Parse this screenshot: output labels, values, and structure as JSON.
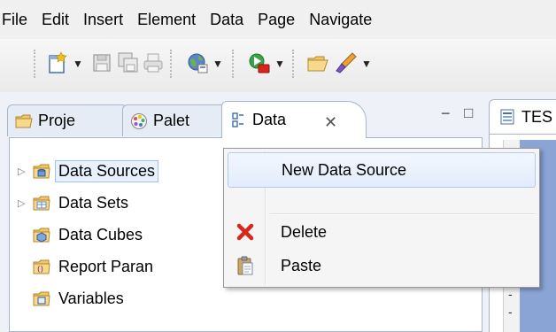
{
  "menubar": {
    "items": [
      "File",
      "Edit",
      "Insert",
      "Element",
      "Data",
      "Page",
      "Navigate"
    ]
  },
  "toolbar": {
    "buttons": [
      "new-file-icon",
      "save-icon",
      "save-all-icon",
      "print-icon",
      "globe-run-icon",
      "run-report-icon",
      "open-folder-icon",
      "brush-icon"
    ]
  },
  "tabs": {
    "project": "Proje",
    "palette": "Palet",
    "data": "Data",
    "close": "✕",
    "minimize": "−",
    "maximize": "□"
  },
  "editor_tab": {
    "label": "TES"
  },
  "tree": {
    "items": [
      {
        "label": "Data Sources",
        "expandable": true,
        "selected": true
      },
      {
        "label": "Data Sets",
        "expandable": true,
        "selected": false
      },
      {
        "label": "Data Cubes",
        "expandable": false,
        "selected": false
      },
      {
        "label": "Report Paran",
        "expandable": false,
        "selected": false
      },
      {
        "label": "Variables",
        "expandable": false,
        "selected": false
      }
    ]
  },
  "context_menu": {
    "items": [
      {
        "label": "New Data Source",
        "icon": "",
        "highlighted": true
      },
      {
        "label": "Delete",
        "icon": "delete-icon",
        "highlighted": false
      },
      {
        "label": "Paste",
        "icon": "paste-icon",
        "highlighted": false
      }
    ]
  },
  "colors": {
    "accent": "#9fc3ef",
    "delete_red": "#d9261c",
    "canvas_blue": "#8aa4d6"
  }
}
